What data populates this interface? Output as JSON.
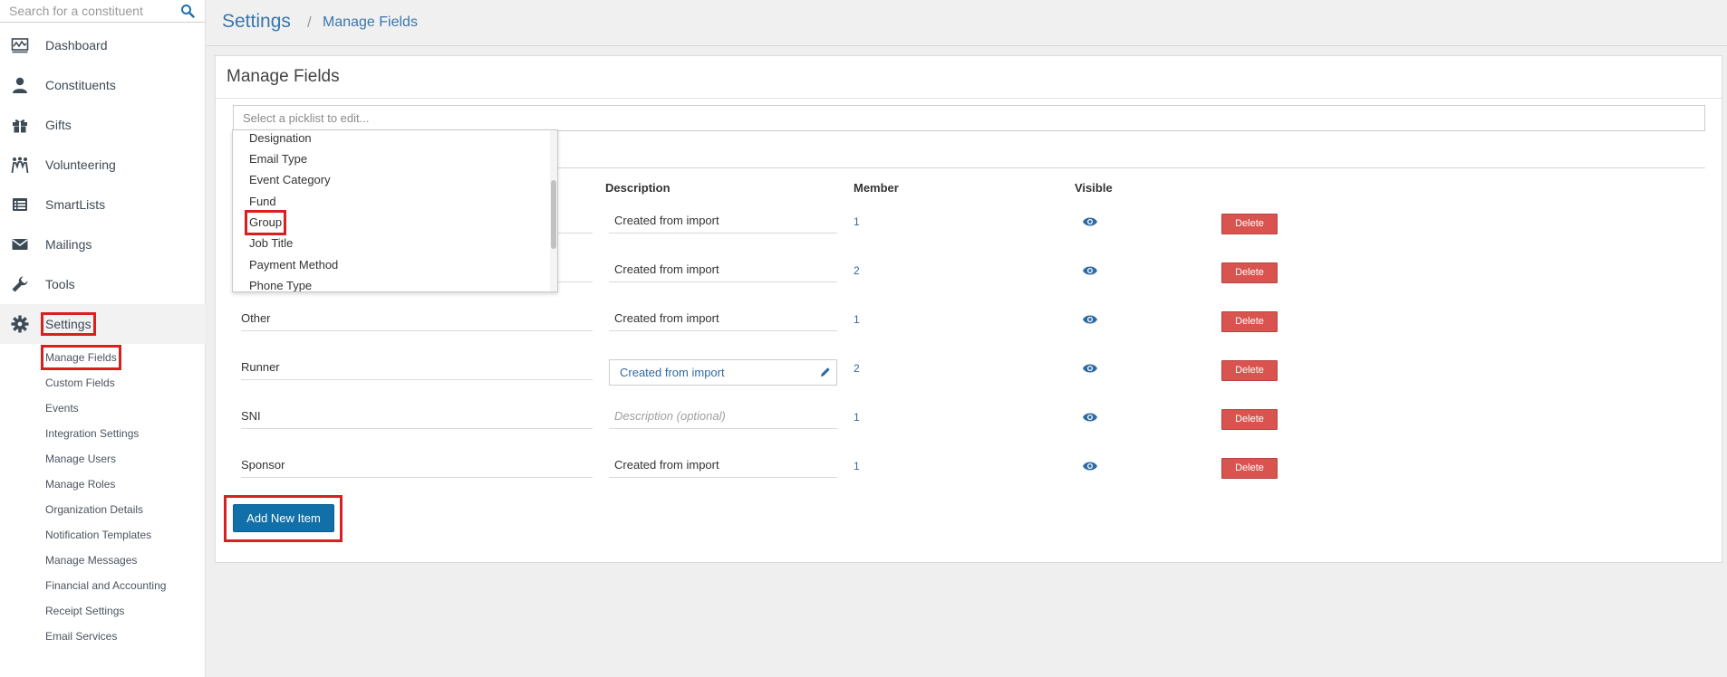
{
  "search": {
    "placeholder": "Search for a constituent"
  },
  "nav": {
    "items": [
      {
        "label": "Dashboard",
        "icon": "dashboard-icon"
      },
      {
        "label": "Constituents",
        "icon": "person-icon"
      },
      {
        "label": "Gifts",
        "icon": "gift-icon"
      },
      {
        "label": "Volunteering",
        "icon": "volunteer-icon"
      },
      {
        "label": "SmartLists",
        "icon": "list-icon"
      },
      {
        "label": "Mailings",
        "icon": "mail-icon"
      },
      {
        "label": "Tools",
        "icon": "wrench-icon"
      },
      {
        "label": "Settings",
        "icon": "gear-icon"
      }
    ],
    "settings_sub": [
      "Manage Fields",
      "Custom Fields",
      "Events",
      "Integration Settings",
      "Manage Users",
      "Manage Roles",
      "Organization Details",
      "Notification Templates",
      "Manage Messages",
      "Financial and Accounting",
      "Receipt Settings",
      "Email Services"
    ]
  },
  "header": {
    "crumb1": "Settings",
    "separator": "/",
    "crumb2": "Manage Fields"
  },
  "panel": {
    "title": "Manage Fields",
    "picklist_placeholder": "Select a picklist to edit...",
    "columns": {
      "description": "Description",
      "member": "Member",
      "visible": "Visible"
    },
    "rows": [
      {
        "name": "",
        "description": "Created from import",
        "member": "1",
        "delete": "Delete"
      },
      {
        "name": "",
        "description": "Created from import",
        "member": "2",
        "delete": "Delete"
      },
      {
        "name": "Other",
        "description": "Created from import",
        "member": "1",
        "delete": "Delete"
      },
      {
        "name": "Runner",
        "description": "Created from import",
        "member": "2",
        "delete": "Delete"
      },
      {
        "name": "SNI",
        "description": "Description (optional)",
        "member": "1",
        "delete": "Delete"
      },
      {
        "name": "Sponsor",
        "description": "Created from import",
        "member": "1",
        "delete": "Delete"
      }
    ],
    "add_button": "Add New Item"
  },
  "dropdown": {
    "options": [
      "Designation",
      "Email Type",
      "Event Category",
      "Fund",
      "Group",
      "Job Title",
      "Payment Method",
      "Phone Type"
    ],
    "highlighted": "Group"
  },
  "colors": {
    "accent": "#1170a8",
    "link": "#2f6aa3",
    "danger": "#d9534f",
    "highlight": "#d91f1f"
  }
}
